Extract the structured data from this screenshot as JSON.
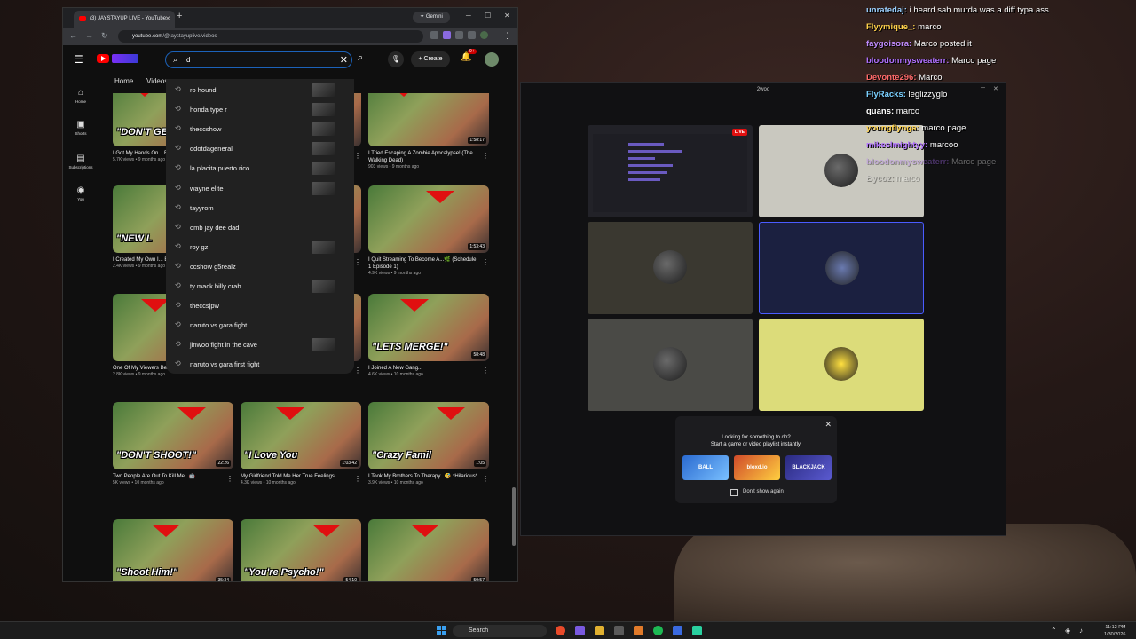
{
  "browser": {
    "tab_title": "(3) JAYSTAYUP LIVE - YouTube",
    "gemini_label": "Gemini",
    "url_host": "youtube.com",
    "url_path": "/@jaystayuplive/videos"
  },
  "youtube": {
    "search_value": "d",
    "create_label": "Create",
    "notif_count": "9+",
    "rail": [
      "Home",
      "Shorts",
      "Subscriptions",
      "You"
    ],
    "channel_tabs": [
      "Home",
      "Videos"
    ],
    "suggestions": [
      {
        "text": "ro hound",
        "thumb": true
      },
      {
        "text": "honda type r",
        "thumb": true
      },
      {
        "text": "theccshow",
        "thumb": true
      },
      {
        "text": "ddotdageneral",
        "thumb": true
      },
      {
        "text": "la placita puerto rico",
        "thumb": true
      },
      {
        "text": "wayne elite",
        "thumb": true
      },
      {
        "text": "tayyrom",
        "thumb": false
      },
      {
        "text": "omb jay dee dad",
        "thumb": false
      },
      {
        "text": "roy gz",
        "thumb": true
      },
      {
        "text": "ccshow g5realz",
        "thumb": false
      },
      {
        "text": "ty mack billy crab",
        "thumb": true
      },
      {
        "text": "theccsjpw",
        "thumb": false
      },
      {
        "text": "naruto vs gara fight",
        "thumb": false
      },
      {
        "text": "jinwoo fight in the cave",
        "thumb": true
      },
      {
        "text": "naruto vs gara first fight",
        "thumb": false
      }
    ],
    "videos": [
      {
        "cap": "\"DON'T GE",
        "dur": "",
        "title": "I Got My Hands On... Episode 5)",
        "meta": "5.7K views • 9 months ago"
      },
      {
        "cap": "",
        "dur": "",
        "title": "",
        "meta": ""
      },
      {
        "cap": "",
        "dur": "1:58:17",
        "title": "I Tried Escaping A Zombie Apocalypse! (The Walking Dead)",
        "meta": "903 views • 9 months ago"
      },
      {
        "cap": "\"NEW L",
        "dur": "",
        "title": "I Created My Own I... Episode 3)",
        "meta": "2.4K views • 9 months ago"
      },
      {
        "cap": "",
        "dur": "",
        "title": "",
        "meta": ""
      },
      {
        "cap": "",
        "dur": "1:53:43",
        "title": "I Quit Streaming To Become A...🌿 (Schedule 1 Episode 1)",
        "meta": "4.9K views • 9 months ago"
      },
      {
        "cap": "",
        "dur": "",
        "title": "One Of My Viewers Being A Catfish...",
        "meta": "2.8K views • 9 months ago"
      },
      {
        "cap": "",
        "dur": "",
        "title": "",
        "meta": ""
      },
      {
        "cap": "\"LETS MERGE!\"",
        "dur": "58:48",
        "title": "I Joined A New Gang...",
        "meta": "4.6K views • 10 months ago"
      },
      {
        "cap": "\"DON'T SHOOT!\"",
        "dur": "22:26",
        "title": "Two People Are Out To Kill Me...🤖",
        "meta": "5K views • 10 months ago"
      },
      {
        "cap": "\"I Love You",
        "dur": "1:03:42",
        "title": "My Girlfriend Told Me Her True Feelings...",
        "meta": "4.3K views • 10 months ago"
      },
      {
        "cap": "\"Crazy Famil",
        "dur": "1:05",
        "title": "I Took My Brothers To Therapy...🤣 *Hilarious*",
        "meta": "3.9K views • 10 months ago"
      },
      {
        "cap": "\"Shoot Him!\"",
        "dur": "35:34",
        "title": "",
        "meta": ""
      },
      {
        "cap": "\"You're Psycho!\"",
        "dur": "54:10",
        "title": "",
        "meta": ""
      },
      {
        "cap": "",
        "dur": "50:57",
        "title": "",
        "meta": ""
      }
    ]
  },
  "call": {
    "title": "2woo",
    "live_badge": "LIVE",
    "game_panel_title_1": "Looking for something to do?",
    "game_panel_title_2": "Start a game or video playlist instantly.",
    "games": [
      "BALL",
      "bloxd.io",
      "BLACKJACK"
    ],
    "dont_show": "Don't show again"
  },
  "chat": [
    {
      "user": "unratedaj:",
      "msg": "i heard sah murda was a diff typa ass",
      "color": "#9ad0ff",
      "faded": false
    },
    {
      "user": "Flyymique_:",
      "msg": "marco",
      "color": "#ffd24a",
      "faded": false
    },
    {
      "user": "faygoisora:",
      "msg": "Marco posted it",
      "color": "#c08cff",
      "faded": false
    },
    {
      "user": "bloodonmysweaterr:",
      "msg": "Marco page",
      "color": "#b070ff",
      "faded": false
    },
    {
      "user": "Devonte296:",
      "msg": "Marco",
      "color": "#ff6a6a",
      "faded": false
    },
    {
      "user": "FlyRacks:",
      "msg": "leglizzyglo",
      "color": "#7ad0ff",
      "faded": false
    },
    {
      "user": "quans:",
      "msg": "marco",
      "color": "#ffffff",
      "faded": false
    },
    {
      "user": "youngflynga:",
      "msg": "marco page",
      "color": "#ffd24a",
      "faded": false
    },
    {
      "user": "mikeslmightyy:",
      "msg": "marcoo",
      "color": "#b070ff",
      "faded": false
    },
    {
      "user": "bloodonmysweaterr:",
      "msg": "Marco page",
      "color": "#b070ff",
      "faded": true
    },
    {
      "user": "Bycoz:",
      "msg": "marco",
      "color": "#cccccc",
      "faded": true
    }
  ],
  "taskbar": {
    "search_label": "Search",
    "time": "11:12 PM",
    "date": "1/30/2026"
  },
  "colors": {
    "yt_red": "#ff0000",
    "search_focus": "#1c62b9",
    "active_tile_border": "#4a5cff"
  }
}
